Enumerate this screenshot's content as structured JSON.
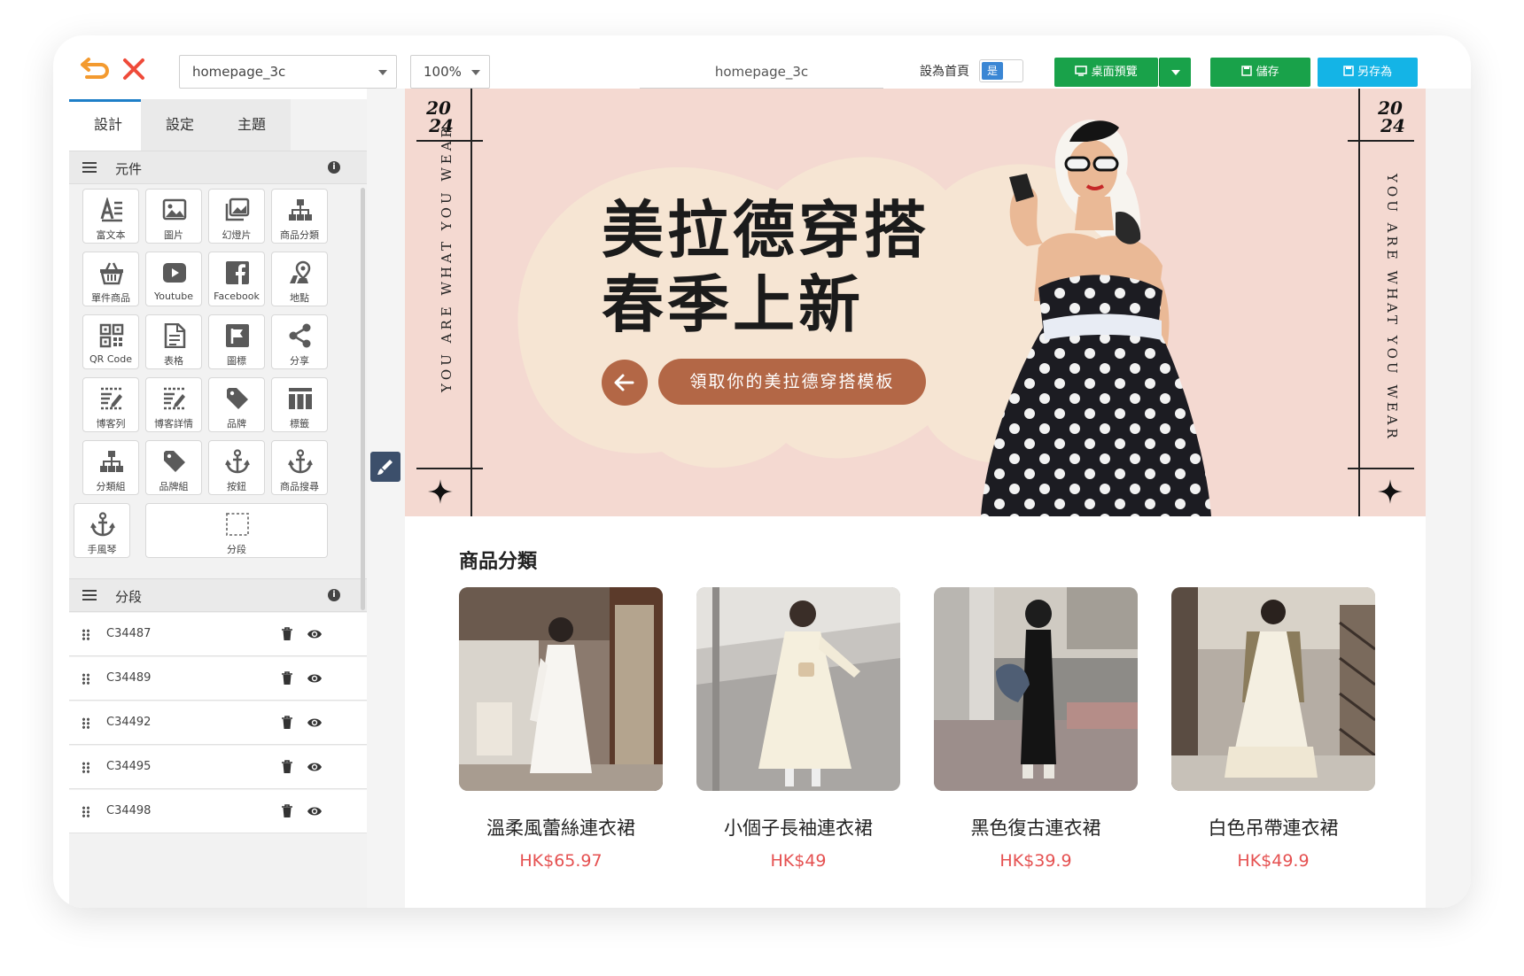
{
  "toolbar": {
    "page_select": "homepage_3c",
    "zoom_select": "100%",
    "page_name": "homepage_3c",
    "set_home_label": "設為首頁",
    "set_home_value": "是",
    "preview_label": "桌面預覽",
    "save_label": "儲存",
    "save_as_label": "另存為"
  },
  "sidebar": {
    "tabs": [
      "設計",
      "設定",
      "主題"
    ],
    "components_title": "元件",
    "components": [
      {
        "label": "富文本",
        "icon": "rich-text-icon"
      },
      {
        "label": "圖片",
        "icon": "image-icon"
      },
      {
        "label": "幻燈片",
        "icon": "slideshow-icon"
      },
      {
        "label": "商品分類",
        "icon": "category-icon"
      },
      {
        "label": "單件商品",
        "icon": "basket-icon"
      },
      {
        "label": "Youtube",
        "icon": "youtube-icon"
      },
      {
        "label": "Facebook",
        "icon": "facebook-icon"
      },
      {
        "label": "地點",
        "icon": "location-icon"
      },
      {
        "label": "QR Code",
        "icon": "qr-code-icon"
      },
      {
        "label": "表格",
        "icon": "form-icon"
      },
      {
        "label": "圖標",
        "icon": "flag-icon"
      },
      {
        "label": "分享",
        "icon": "share-icon"
      },
      {
        "label": "博客列",
        "icon": "blog-list-icon"
      },
      {
        "label": "博客詳情",
        "icon": "blog-detail-icon"
      },
      {
        "label": "品牌",
        "icon": "brand-tag-icon"
      },
      {
        "label": "標籤",
        "icon": "tags-icon"
      },
      {
        "label": "分類組",
        "icon": "category-group-icon"
      },
      {
        "label": "品牌組",
        "icon": "brand-group-icon"
      },
      {
        "label": "按鈕",
        "icon": "anchor-icon"
      },
      {
        "label": "商品搜尋",
        "icon": "anchor-search-icon"
      },
      {
        "label": "手風琴",
        "icon": "accordion-anchor-icon"
      },
      {
        "label": "分段",
        "icon": "section-dashed-icon"
      }
    ],
    "segments_title": "分段",
    "segments": [
      "C34487",
      "C34489",
      "C34492",
      "C34495",
      "C34498"
    ]
  },
  "hero": {
    "year_top": "20",
    "year_bottom": "24",
    "side_text": "YOU ARE WHAT YOU WEAR",
    "headline_line1": "美拉德穿搭",
    "headline_line2": "春季上新",
    "cta_label": "領取你的美拉德穿搭模板"
  },
  "category_section": {
    "title": "商品分類",
    "products": [
      {
        "name": "溫柔風蕾絲連衣裙",
        "price": "HK$65.97"
      },
      {
        "name": "小個子長袖連衣裙",
        "price": "HK$49"
      },
      {
        "name": "黑色復古連衣裙",
        "price": "HK$39.9"
      },
      {
        "name": "白色吊帶連衣裙",
        "price": "HK$49.9"
      }
    ]
  },
  "colors": {
    "accent_blue": "#1e7fc8",
    "green_button": "#19a24a",
    "cyan_button": "#14b4e6",
    "hero_bg": "#f4d9d1",
    "hero_cta": "#b36746",
    "price_red": "#e55050"
  }
}
